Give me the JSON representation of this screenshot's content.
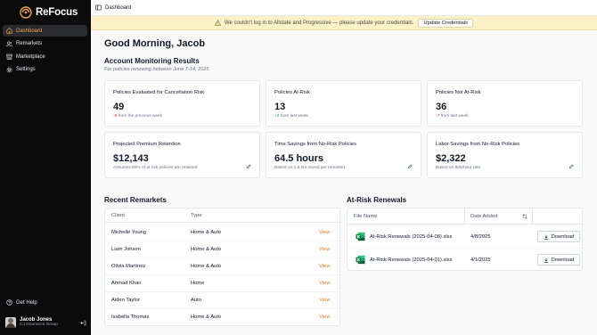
{
  "brand": {
    "name": "ReFocus"
  },
  "nav": [
    {
      "label": "Dashboard",
      "icon": "home-icon",
      "active": true
    },
    {
      "label": "Remarkets",
      "icon": "users-icon",
      "active": false
    },
    {
      "label": "Marketplace",
      "icon": "store-icon",
      "active": false
    },
    {
      "label": "Settings",
      "icon": "gear-icon",
      "active": false
    }
  ],
  "help": {
    "label": "Get Help",
    "icon": "help-icon"
  },
  "user": {
    "name": "Jacob Jones",
    "org": "CJ Insurance Group"
  },
  "topbar": {
    "breadcrumb": "Dashboard"
  },
  "alert": {
    "message": "We couldn't log in to Allstate and Progressive — please update your credentials.",
    "button": "Update Credentials"
  },
  "greeting": "Good Morning, Jacob",
  "monitoring": {
    "title": "Account Monitoring Results",
    "subtitle": "For policies renewing between June 7-14, 2025"
  },
  "cards": [
    {
      "label": "Policies Evaluated for Cancellation Risk",
      "value": "49",
      "delta": "-5",
      "note": " from the previous week",
      "delta_type": "neg"
    },
    {
      "label": "Policies At-Risk",
      "value": "13",
      "delta": "+2",
      "note": " from last week",
      "delta_type": "pos"
    },
    {
      "label": "Policies Not At-Risk",
      "value": "36",
      "delta": "-7",
      "note": " from last week",
      "delta_type": "neg"
    },
    {
      "label": "Projected Premium Retention",
      "value": "$12,143",
      "note_full": "Assumes 80% of at risk policies are retained"
    },
    {
      "label": "Time Savings from No-Risk Policies",
      "value": "64.5 hours",
      "note_full": "Based on 1.5 hrs saved per remarket"
    },
    {
      "label": "Labor Savings from No-Risk Policies",
      "value": "$2,322",
      "note_full": "Based on $36/hour rate"
    }
  ],
  "remarkets": {
    "title": "Recent Remarkets",
    "columns": [
      "Client",
      "Type"
    ],
    "rows": [
      {
        "client": "Michelle Young",
        "type": "Home & Auto",
        "action": "View"
      },
      {
        "client": "Liam Johson",
        "type": "Home & Auto",
        "action": "View"
      },
      {
        "client": "Olivia Martinez",
        "type": "Home & Auto",
        "action": "View"
      },
      {
        "client": "Ahmad Khan",
        "type": "Home",
        "action": "View"
      },
      {
        "client": "Aiden Taylor",
        "type": "Auto",
        "action": "View"
      },
      {
        "client": "Isabella Thomas",
        "type": "Home & Auto",
        "action": "View"
      }
    ]
  },
  "renewals": {
    "title": "At-Risk Renewals",
    "columns": [
      "File Name",
      "Date Added"
    ],
    "rows": [
      {
        "file": "At-Risk Renewals (2025-04-08).xlsx",
        "date": "4/8/2025",
        "action": "Download"
      },
      {
        "file": "At-Risk Renewals (2025-04-01).xlsx",
        "date": "4/1/2025",
        "action": "Download"
      }
    ]
  },
  "colors": {
    "accent": "#ea7a1e",
    "sidebar": "#0b0b0c",
    "alert_bg": "#fdf2c7",
    "excel": "#1d6f42"
  }
}
